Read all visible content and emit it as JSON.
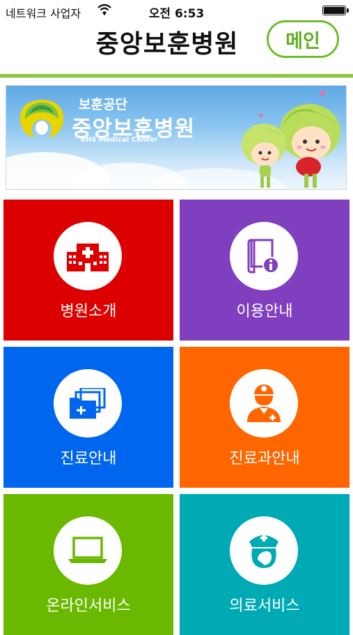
{
  "status_bar": {
    "carrier": "네트워크 사업자",
    "time": "오전 6:53"
  },
  "header": {
    "title": "중앙보훈병원",
    "main_button": "메인"
  },
  "banner": {
    "subtitle": "보훈공단",
    "name": "중앙보훈병원",
    "english": "VHS Medical Center"
  },
  "menu": [
    {
      "label": "병원소개",
      "color": "#dd0000",
      "icon": "hospital-icon"
    },
    {
      "label": "이용안내",
      "color": "#7f3fbf",
      "icon": "book-info-icon"
    },
    {
      "label": "진료안내",
      "color": "#0066ee",
      "icon": "folders-icon"
    },
    {
      "label": "진료과안내",
      "color": "#ff6600",
      "icon": "doctor-icon"
    },
    {
      "label": "온라인서비스",
      "color": "#6ab800",
      "icon": "laptop-icon"
    },
    {
      "label": "의료서비스",
      "color": "#00aab5",
      "icon": "nurse-icon"
    }
  ],
  "colors": {
    "accent_green": "#6fbc2c",
    "rule_green": "#8cc63f"
  }
}
